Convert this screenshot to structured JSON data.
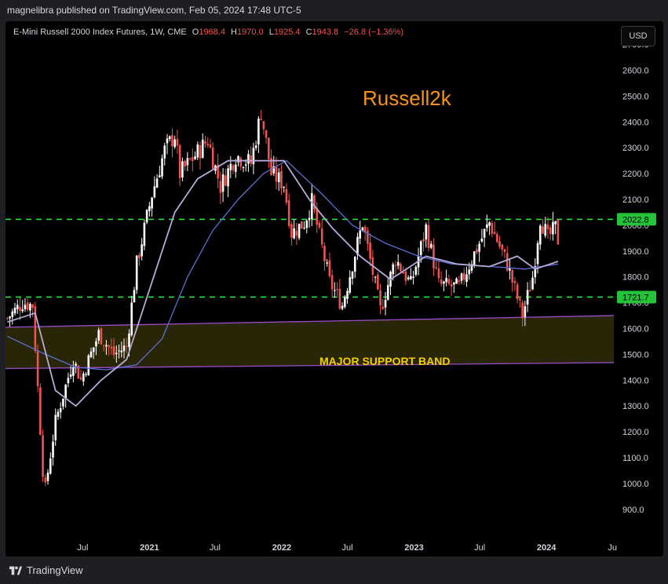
{
  "header": {
    "published": "magnelibra published on TradingView.com, Feb 05, 2024 17:48 UTC-5"
  },
  "legend": {
    "symbol": "E-Mini Russell 2000 Index Futures, 1W, CME",
    "open_label": "O",
    "open_value": "1968.4",
    "high_label": "H",
    "high_value": "1970.0",
    "low_label": "L",
    "low_value": "1925.4",
    "close_label": "C",
    "close_value": "1943.8",
    "change": "−26.8 (−1.36%)"
  },
  "currency_button": "USD",
  "footer": {
    "brand": "TradingView"
  },
  "colors": {
    "up": "#ffffff",
    "down": "#ef5350",
    "level": "#27e53c",
    "band_fill": "#2e2a08",
    "band_line": "#9b4dca",
    "ma_fast": "#b8a9d9",
    "ma_slow": "#5c6fd6",
    "title": "#f7931a",
    "band_text": "#f5d000"
  },
  "chart_data": {
    "type": "candlestick",
    "title": "Russell2k",
    "annotation": "MAJOR SUPPORT BAND",
    "ylim": [
      790,
      2790
    ],
    "y_ticks": [
      "2700.0",
      "2600.0",
      "2500.0",
      "2400.0",
      "2300.0",
      "2200.0",
      "2100.0",
      "2000.0",
      "1900.0",
      "1800.0",
      "1700.0",
      "1600.0",
      "1500.0",
      "1400.0",
      "1300.0",
      "1200.0",
      "1100.0",
      "1000.0",
      "900.0"
    ],
    "x_ticks": [
      {
        "label": "Jul",
        "date": "2020-07-01"
      },
      {
        "label": "2021",
        "date": "2021-01-01"
      },
      {
        "label": "Jul",
        "date": "2021-07-01"
      },
      {
        "label": "2022",
        "date": "2022-01-01"
      },
      {
        "label": "Jul",
        "date": "2022-07-01"
      },
      {
        "label": "2023",
        "date": "2023-01-01"
      },
      {
        "label": "Jul",
        "date": "2023-07-01"
      },
      {
        "label": "2024",
        "date": "2024-01-01"
      },
      {
        "label": "Ju",
        "date": "2024-07-01"
      }
    ],
    "x_range": [
      "2019-12-01",
      "2024-07-05"
    ],
    "levels": [
      {
        "name": "resistance",
        "value": 2022.8,
        "label": "2022.8"
      },
      {
        "name": "support",
        "value": 1721.7,
        "label": "1721.7"
      }
    ],
    "support_band": {
      "upper": [
        {
          "date": "2019-12-01",
          "value": 1605
        },
        {
          "date": "2024-07-05",
          "value": 1650
        }
      ],
      "lower": [
        {
          "date": "2019-12-01",
          "value": 1445
        },
        {
          "date": "2024-07-05",
          "value": 1468
        }
      ]
    },
    "close_path": [
      {
        "date": "2019-12-06",
        "value": 1640
      },
      {
        "date": "2020-01-17",
        "value": 1700
      },
      {
        "date": "2020-02-14",
        "value": 1690
      },
      {
        "date": "2020-03-13",
        "value": 1050
      },
      {
        "date": "2020-03-20",
        "value": 980
      },
      {
        "date": "2020-04-17",
        "value": 1240
      },
      {
        "date": "2020-06-05",
        "value": 1480
      },
      {
        "date": "2020-06-26",
        "value": 1400
      },
      {
        "date": "2020-08-14",
        "value": 1580
      },
      {
        "date": "2020-09-25",
        "value": 1500
      },
      {
        "date": "2020-10-30",
        "value": 1530
      },
      {
        "date": "2020-11-27",
        "value": 1850
      },
      {
        "date": "2021-01-08",
        "value": 2120
      },
      {
        "date": "2021-02-12",
        "value": 2290
      },
      {
        "date": "2021-03-12",
        "value": 2350
      },
      {
        "date": "2021-03-26",
        "value": 2200
      },
      {
        "date": "2021-05-07",
        "value": 2270
      },
      {
        "date": "2021-06-11",
        "value": 2330
      },
      {
        "date": "2021-07-16",
        "value": 2150
      },
      {
        "date": "2021-08-27",
        "value": 2270
      },
      {
        "date": "2021-10-08",
        "value": 2240
      },
      {
        "date": "2021-11-05",
        "value": 2440
      },
      {
        "date": "2021-12-03",
        "value": 2200
      },
      {
        "date": "2022-01-07",
        "value": 2160
      },
      {
        "date": "2022-01-28",
        "value": 1970
      },
      {
        "date": "2022-03-04",
        "value": 2010
      },
      {
        "date": "2022-03-25",
        "value": 2090
      },
      {
        "date": "2022-05-13",
        "value": 1780
      },
      {
        "date": "2022-06-17",
        "value": 1690
      },
      {
        "date": "2022-08-12",
        "value": 2010
      },
      {
        "date": "2022-09-30",
        "value": 1670
      },
      {
        "date": "2022-11-11",
        "value": 1870
      },
      {
        "date": "2022-12-23",
        "value": 1770
      },
      {
        "date": "2023-02-03",
        "value": 1990
      },
      {
        "date": "2023-03-10",
        "value": 1770
      },
      {
        "date": "2023-05-05",
        "value": 1760
      },
      {
        "date": "2023-06-16",
        "value": 1890
      },
      {
        "date": "2023-07-28",
        "value": 2010
      },
      {
        "date": "2023-09-15",
        "value": 1850
      },
      {
        "date": "2023-10-27",
        "value": 1650
      },
      {
        "date": "2023-11-24",
        "value": 1800
      },
      {
        "date": "2023-12-15",
        "value": 2030
      },
      {
        "date": "2024-01-05",
        "value": 1950
      },
      {
        "date": "2024-01-26",
        "value": 1990
      },
      {
        "date": "2024-02-02",
        "value": 1943.8
      }
    ],
    "ma_fast": [
      {
        "date": "2019-12-06",
        "value": 1625
      },
      {
        "date": "2020-02-21",
        "value": 1660
      },
      {
        "date": "2020-04-17",
        "value": 1360
      },
      {
        "date": "2020-06-12",
        "value": 1300
      },
      {
        "date": "2020-08-21",
        "value": 1400
      },
      {
        "date": "2020-10-30",
        "value": 1480
      },
      {
        "date": "2021-01-08",
        "value": 1780
      },
      {
        "date": "2021-03-12",
        "value": 2050
      },
      {
        "date": "2021-05-14",
        "value": 2180
      },
      {
        "date": "2021-08-06",
        "value": 2250
      },
      {
        "date": "2021-10-29",
        "value": 2250
      },
      {
        "date": "2022-01-07",
        "value": 2250
      },
      {
        "date": "2022-03-18",
        "value": 2100
      },
      {
        "date": "2022-05-20",
        "value": 1990
      },
      {
        "date": "2022-08-05",
        "value": 1880
      },
      {
        "date": "2022-10-28",
        "value": 1790
      },
      {
        "date": "2023-02-03",
        "value": 1880
      },
      {
        "date": "2023-04-28",
        "value": 1850
      },
      {
        "date": "2023-07-28",
        "value": 1840
      },
      {
        "date": "2023-10-13",
        "value": 1880
      },
      {
        "date": "2023-12-01",
        "value": 1830
      },
      {
        "date": "2024-02-02",
        "value": 1860
      }
    ],
    "ma_slow": [
      {
        "date": "2019-12-06",
        "value": 1570
      },
      {
        "date": "2020-03-20",
        "value": 1500
      },
      {
        "date": "2020-06-12",
        "value": 1450
      },
      {
        "date": "2020-09-04",
        "value": 1440
      },
      {
        "date": "2020-11-27",
        "value": 1460
      },
      {
        "date": "2021-02-05",
        "value": 1560
      },
      {
        "date": "2021-04-16",
        "value": 1800
      },
      {
        "date": "2021-06-25",
        "value": 1980
      },
      {
        "date": "2021-09-03",
        "value": 2100
      },
      {
        "date": "2021-11-12",
        "value": 2200
      },
      {
        "date": "2022-01-14",
        "value": 2250
      },
      {
        "date": "2022-04-15",
        "value": 2130
      },
      {
        "date": "2022-07-15",
        "value": 2000
      },
      {
        "date": "2022-10-14",
        "value": 1930
      },
      {
        "date": "2023-01-13",
        "value": 1880
      },
      {
        "date": "2023-04-14",
        "value": 1850
      },
      {
        "date": "2023-08-04",
        "value": 1840
      },
      {
        "date": "2023-11-03",
        "value": 1830
      },
      {
        "date": "2024-02-02",
        "value": 1850
      }
    ]
  }
}
